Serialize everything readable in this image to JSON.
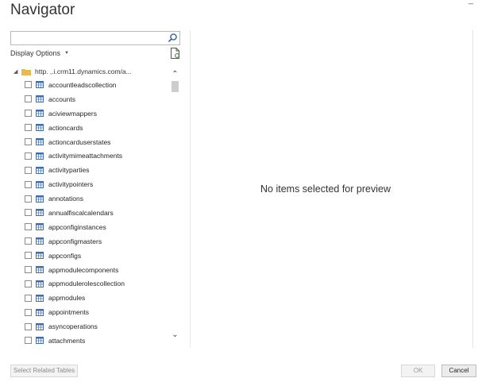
{
  "dialog": {
    "title": "Navigator"
  },
  "search": {
    "value": "",
    "placeholder": ""
  },
  "display_options": {
    "label": "Display Options"
  },
  "tree": {
    "root_label": "http.                ,.i.crm11.dynamics.com/a...",
    "items": [
      {
        "label": "accountleadscollection"
      },
      {
        "label": "accounts"
      },
      {
        "label": "aciviewmappers"
      },
      {
        "label": "actioncards"
      },
      {
        "label": "actioncarduserstates"
      },
      {
        "label": "activitymimeattachments"
      },
      {
        "label": "activityparties"
      },
      {
        "label": "activitypointers"
      },
      {
        "label": "annotations"
      },
      {
        "label": "annualfiscalcalendars"
      },
      {
        "label": "appconfiginstances"
      },
      {
        "label": "appconfigmasters"
      },
      {
        "label": "appconfigs"
      },
      {
        "label": "appmodulecomponents"
      },
      {
        "label": "appmodulerolescollection"
      },
      {
        "label": "appmodules"
      },
      {
        "label": "appointments"
      },
      {
        "label": "asyncoperations"
      },
      {
        "label": "attachments"
      }
    ]
  },
  "preview": {
    "empty_message": "No items selected for preview"
  },
  "buttons": {
    "select_related": "Select Related Tables",
    "ok": "OK",
    "cancel": "Cancel"
  },
  "colors": {
    "table_icon": "#3d6fb0",
    "folder": "#e7b94f",
    "search_icon": "#2a64b3"
  }
}
